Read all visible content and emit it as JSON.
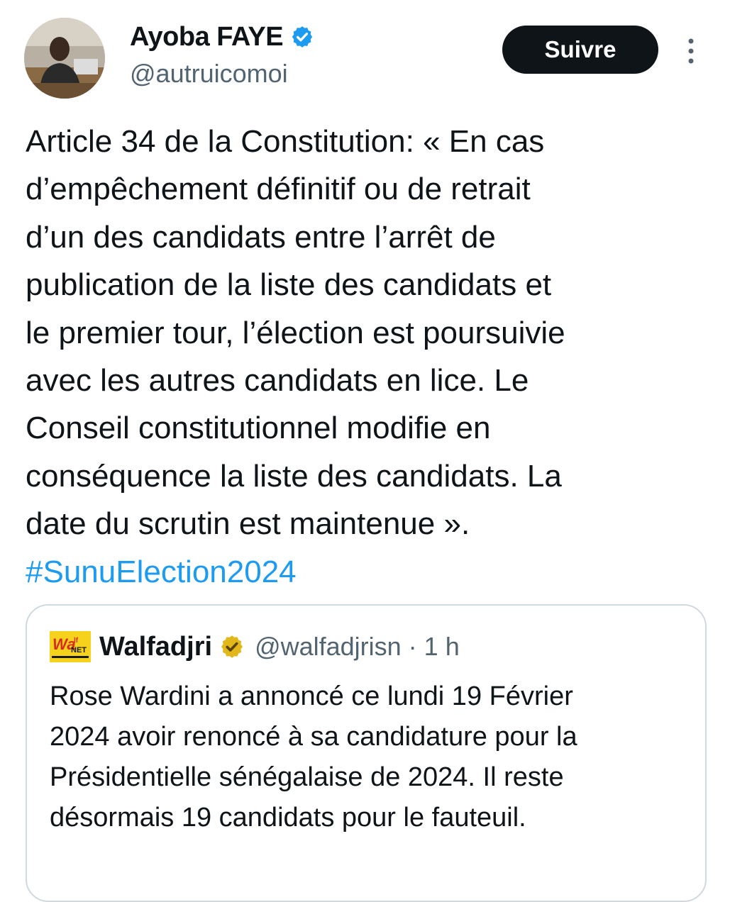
{
  "author": {
    "display_name": "Ayoba FAYE",
    "handle": "@autruicomoi",
    "verified_icon": "verified-badge-icon",
    "verified_color": "#1d9bf0"
  },
  "follow_label": "Suivre",
  "more_icon": "more-vertical-icon",
  "tweet": {
    "lines": [
      "Article 34 de la Constitution: « En cas",
      "d’empêchement définitif ou de retrait",
      "d’un des candidats entre l’arrêt de",
      "publication de la liste des candidats et",
      "le premier tour, l’élection est poursuivie",
      "avec les autres candidats en lice. Le",
      "Conseil constitutionnel modifie en",
      "conséquence la liste des candidats. La",
      "date du scrutin est maintenue »."
    ],
    "hashtag": "#SunuElection2024",
    "hashtag_color": "#1d9bf0"
  },
  "quoted": {
    "logo_text": "Walf NET",
    "name": "Walfadjri",
    "badge_icon": "gold-verified-badge-icon",
    "badge_color": "#e2b719",
    "handle_time": "@walfadjrisn · 1 h",
    "lines": [
      "Rose Wardini a annoncé ce lundi 19 Février",
      "2024 avoir renoncé à sa candidature pour la",
      "Présidentielle sénégalaise de 2024. Il reste",
      "désormais 19 candidats pour le fauteuil."
    ]
  }
}
